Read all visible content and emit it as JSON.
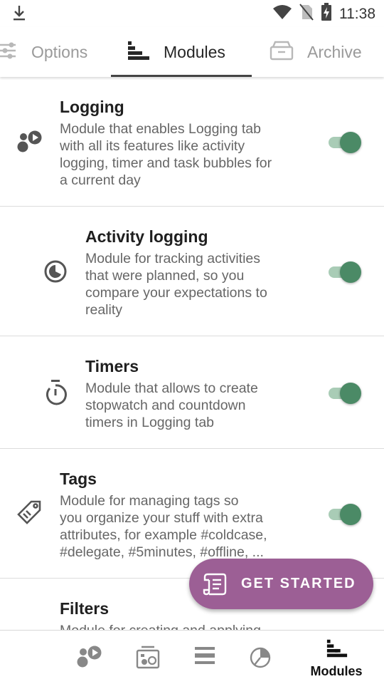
{
  "status_bar": {
    "time": "11:38",
    "icons": [
      "download-icon",
      "wifi-icon",
      "no-sim-icon",
      "battery-charging-icon"
    ]
  },
  "tabs": [
    {
      "label": "Options",
      "icon": "sliders-icon",
      "active": false
    },
    {
      "label": "Modules",
      "icon": "bars-icon",
      "active": true
    },
    {
      "label": "Archive",
      "icon": "archive-icon",
      "active": false
    }
  ],
  "modules": [
    {
      "title": "Logging",
      "description_lines": [
        "Module that enables Logging tab",
        "with all its features like activity",
        "logging, timer and task bubbles for",
        "a current day"
      ],
      "icon": "bubbles-play-icon",
      "enabled": true
    },
    {
      "title": "Activity logging",
      "description_lines": [
        "Module for tracking activities",
        "that were planned, so you",
        "compare your expectations to",
        "reality"
      ],
      "icon": "pie-clock-icon",
      "enabled": true
    },
    {
      "title": "Timers",
      "description_lines": [
        "Module that allows to create",
        "stopwatch and countdown",
        "timers in Logging tab"
      ],
      "icon": "stopwatch-icon",
      "enabled": true
    },
    {
      "title": "Tags",
      "description_lines": [
        "Module for managing tags so",
        "you organize your stuff with extra",
        "attributes, for example #coldcase,",
        "#delegate, #5minutes, #offline, ..."
      ],
      "icon": "tag-icon",
      "enabled": true
    },
    {
      "title": "Filters",
      "description_lines": [
        "Module for creating and applying"
      ],
      "icon": "filter-icon",
      "enabled": true
    }
  ],
  "fab": {
    "label": "GET STARTED",
    "icon": "scroll-icon"
  },
  "bottom_nav": [
    {
      "label": "",
      "icon": "bubbles-play-icon"
    },
    {
      "label": "",
      "icon": "media-box-icon"
    },
    {
      "label": "",
      "icon": "list-bars-icon"
    },
    {
      "label": "",
      "icon": "pie-chart-icon"
    },
    {
      "label": "Modules",
      "icon": "bars-icon",
      "active": true
    }
  ],
  "colors": {
    "accent_green": "#4b8a66",
    "track_green": "#a9ccb6",
    "fab_purple": "#9c5f95",
    "icon_gray": "#555555"
  }
}
